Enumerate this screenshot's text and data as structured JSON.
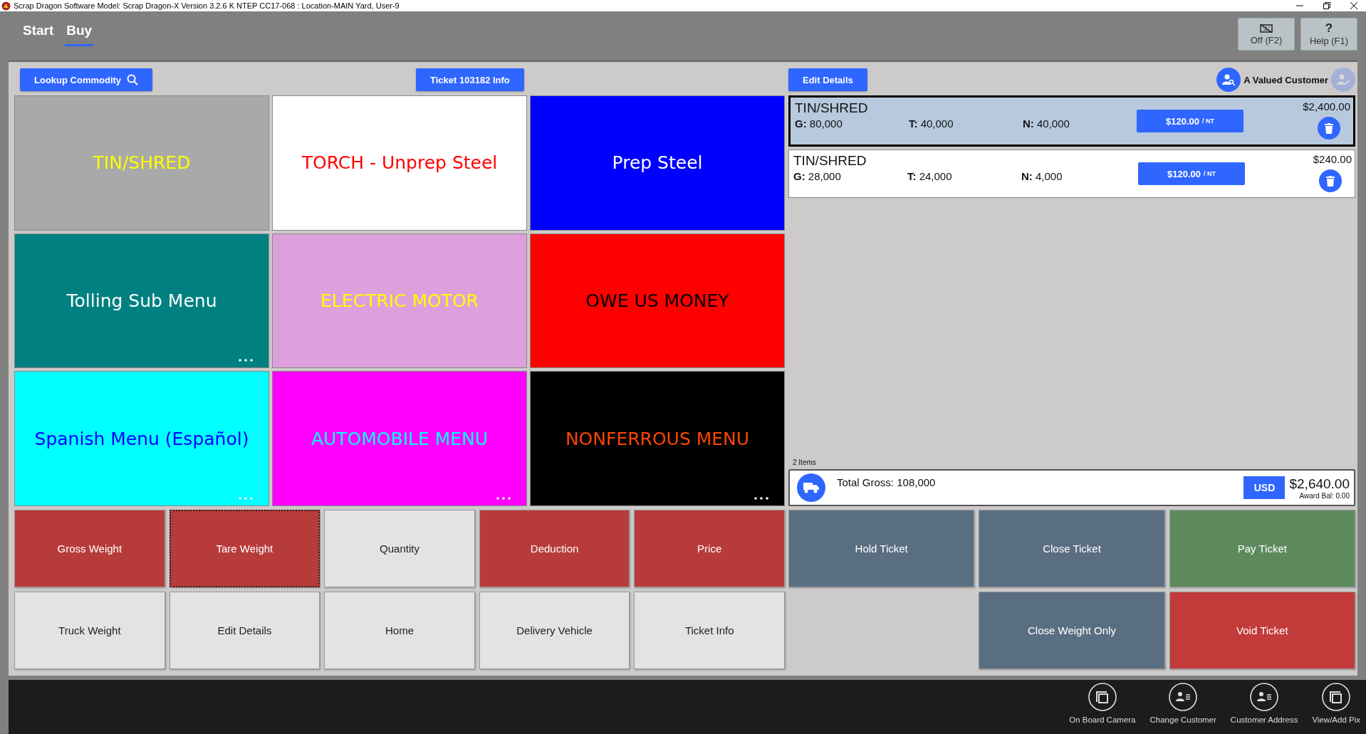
{
  "window": {
    "title": "Scrap Dragon Software Model: Scrap Dragon-X Version 3.2.6 K NTEP CC17-068 : Location-MAIN Yard, User-9"
  },
  "tabs": [
    {
      "label": "Start",
      "selected": false
    },
    {
      "label": "Buy",
      "selected": true
    }
  ],
  "header_buttons": [
    {
      "kind": "keyboard-off",
      "label": "Off (F2)"
    },
    {
      "kind": "help",
      "glyph": "?",
      "label": "Help (F1)"
    }
  ],
  "toolbar": {
    "lookup": "Lookup Commodity",
    "ticket_info": "Ticket 103182 Info",
    "edit_details": "Edit Details",
    "customer": "A Valued Customer",
    "customer_edit_disabled": true
  },
  "tiles": [
    {
      "label": {
        "text": "TIN/SHRED",
        "color": "#ffff00"
      },
      "color": "#a9a9a9",
      "has_submenu": false
    },
    {
      "label": {
        "text": "TORCH - Unprep Steel",
        "color": "#ff0000"
      },
      "color": "#ffffff",
      "has_submenu": false
    },
    {
      "label": {
        "text": "Prep Steel",
        "color": "#ffffff"
      },
      "color": "#0000ff",
      "has_submenu": false
    },
    {
      "label": {
        "text": "Tolling Sub Menu",
        "color": "#ffffff"
      },
      "color": "#008080",
      "has_submenu": true
    },
    {
      "label": {
        "text": "ELECTRIC MOTOR",
        "color": "#ffff00"
      },
      "color": "#dda0dd",
      "has_submenu": false
    },
    {
      "label": {
        "text": "OWE US MONEY",
        "color": "#000000"
      },
      "color": "#ff0000",
      "has_submenu": false
    },
    {
      "label": {
        "text": "Spanish Menu (Español)",
        "color": "#0000ff"
      },
      "color": "#00ffff",
      "has_submenu": true
    },
    {
      "label": {
        "text": "AUTOMOBILE MENU",
        "color": "#00ffff"
      },
      "color": "#ff00ff",
      "has_submenu": true
    },
    {
      "label": {
        "text": "NONFERROUS MENU",
        "color": "#ff4500"
      },
      "color": "#000000",
      "has_submenu": true
    }
  ],
  "ticket_lines": [
    {
      "name": "TIN/SHRED",
      "gross": "**G:** 80,000",
      "tare": "**T:** 40,000",
      "net": "**N:** 40,000",
      "price": "$120.00",
      "unit": "/ NT",
      "amount": "$2,400.00",
      "selected": true
    },
    {
      "name": "TIN/SHRED",
      "gross": "**G:** 28,000",
      "tare": "**T:** 24,000",
      "net": "**N:** 4,000",
      "price": "$120.00",
      "unit": "/ NT",
      "amount": "$240.00",
      "selected": false
    }
  ],
  "summary": {
    "items": "2  Items",
    "total_gross": "Total Gross: 108,000",
    "currency": "USD",
    "total": "$2,640.00",
    "award_balance": "Award Bal:  0.00"
  },
  "actions": [
    {
      "label": "Gross Weight",
      "color": "#b83b3b",
      "focused": false
    },
    {
      "label": "Tare Weight",
      "color": "#b83b3b",
      "focused": true
    },
    {
      "label": "Quantity",
      "color": "#e3e3e3",
      "focused": false
    },
    {
      "label": "Deduction",
      "color": "#b83b3b",
      "focused": false
    },
    {
      "label": "Price",
      "color": "#b83b3b",
      "focused": false
    },
    {
      "label": "Truck Weight",
      "color": "#e3e3e3",
      "focused": false
    },
    {
      "label": "Edit Details",
      "color": "#e3e3e3",
      "focused": false
    },
    {
      "label": "Home",
      "color": "#e3e3e3",
      "focused": false
    },
    {
      "label": "Delivery Vehicle",
      "color": "#e3e3e3",
      "focused": false
    },
    {
      "label": "Ticket Info",
      "color": "#e3e3e3",
      "focused": false
    }
  ],
  "ticket_actions_row_1": [
    {
      "label": "Hold Ticket",
      "color": "#5a6e82"
    },
    {
      "label": "Close Ticket",
      "color": "#5a6e82"
    },
    {
      "label": "Pay Ticket",
      "color": "#5d8a5d"
    }
  ],
  "ticket_actions_row_2": [
    {
      "label": "Close Weight Only",
      "color": "#5a6e82"
    },
    {
      "label": "Void Ticket",
      "color": "#c23a3a"
    }
  ],
  "bottom_tools": [
    {
      "kind": "photos",
      "label": "On Board Camera"
    },
    {
      "kind": "contact",
      "label": "Change Customer"
    },
    {
      "kind": "contact",
      "label": "Customer Address"
    },
    {
      "kind": "photos",
      "label": "View/Add Pix"
    }
  ]
}
